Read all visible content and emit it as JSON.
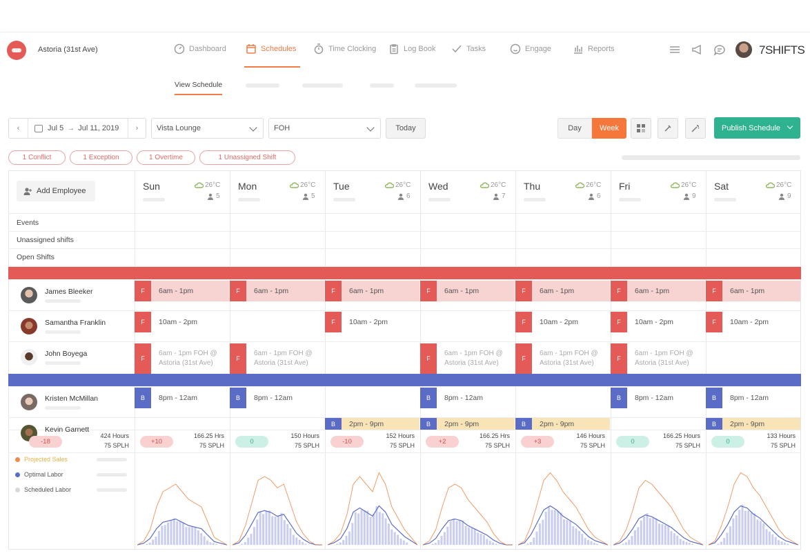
{
  "header": {
    "location": "Astoria (31st Ave)",
    "brand": "7SHIFTS",
    "nav": [
      {
        "label": "Dashboard",
        "icon": "dashboard-icon",
        "active": false
      },
      {
        "label": "Schedules",
        "icon": "calendar-icon",
        "active": true
      },
      {
        "label": "Time Clocking",
        "icon": "stopwatch-icon",
        "active": false
      },
      {
        "label": "Log Book",
        "icon": "clipboard-icon",
        "active": false
      },
      {
        "label": "Tasks",
        "icon": "check-icon",
        "active": false
      },
      {
        "label": "Engage",
        "icon": "smiley-icon",
        "active": false
      },
      {
        "label": "Reports",
        "icon": "bar-chart-icon",
        "active": false
      }
    ]
  },
  "subnav": {
    "active_tab": "View Schedule"
  },
  "toolbar": {
    "date_start": "Jul 5",
    "date_arrow": "→",
    "date_end": "Jul 11, 2019",
    "location_select": "Vista Lounge",
    "department_select": "FOH",
    "today_label": "Today",
    "view_day": "Day",
    "view_week": "Week",
    "publish_label": "Publish Schedule"
  },
  "alerts": [
    "1 Conflict",
    "1 Exception",
    "1 Overtime",
    "1 Unassigned Shift"
  ],
  "grid": {
    "add_employee_label": "Add Employee",
    "section_rows": [
      "Events",
      "Unassigned shifts",
      "Open Shifts"
    ],
    "days": [
      {
        "name": "Sun",
        "temp": "26°C",
        "staff": "5"
      },
      {
        "name": "Mon",
        "temp": "26°C",
        "staff": "5"
      },
      {
        "name": "Tue",
        "temp": "26°C",
        "staff": "6"
      },
      {
        "name": "Wed",
        "temp": "26°C",
        "staff": "7"
      },
      {
        "name": "Thu",
        "temp": "26°C",
        "staff": "6"
      },
      {
        "name": "Fri",
        "temp": "26°C",
        "staff": "9"
      },
      {
        "name": "Sat",
        "temp": "26°C",
        "staff": "9"
      }
    ],
    "employees": [
      {
        "name": "James Bleeker",
        "role": "F",
        "shifts": [
          "6am - 1pm",
          "6am - 1pm",
          "6am - 1pm",
          "6am - 1pm",
          "6am - 1pm",
          "6am - 1pm",
          "6am - 1pm"
        ]
      },
      {
        "name": "Samantha Franklin",
        "role": "F",
        "shifts": [
          "10am - 2pm",
          "",
          "10am - 2pm",
          "",
          "10am - 2pm",
          "10am - 2pm",
          "10am - 2pm"
        ]
      },
      {
        "name": "John Boyega",
        "role": "F",
        "shifts": [
          "6am - 1pm FOH @ Astoria (31st Ave)",
          "6am - 1pm FOH @ Astoria (31st Ave)",
          "",
          "6am - 1pm FOH @ Astoria (31st Ave)",
          "6am - 1pm FOH @ Astoria (31st Ave)",
          "6am - 1pm FOH @ Astoria (31st Ave)",
          ""
        ]
      },
      {
        "name": "Kristen McMillan",
        "role": "B",
        "shifts": [
          "8pm - 12am",
          "8pm - 12am",
          "",
          "8pm - 12am",
          "",
          "8pm - 12am",
          "8pm - 12am"
        ]
      },
      {
        "name": "Kevin Garnett",
        "role": "B",
        "shifts": [
          "",
          "",
          "2pm - 9pm",
          "2pm - 9pm",
          "2pm - 9pm",
          "",
          "2pm - 9pm"
        ]
      }
    ],
    "summary": {
      "total_variance": "-18",
      "total_hours": "424 Hours",
      "total_splh": "75 SPLH",
      "days": [
        {
          "variance": "+10",
          "hours": "166.25 Hrs",
          "splh": "75 SPLH"
        },
        {
          "variance": "0",
          "hours": "150 Hours",
          "splh": "75 SPLH"
        },
        {
          "variance": "-10",
          "hours": "152 Hours",
          "splh": "75 SPLH"
        },
        {
          "variance": "+2",
          "hours": "166.25 Hrs",
          "splh": "75 SPLH"
        },
        {
          "variance": "+3",
          "hours": "146 Hours",
          "splh": "75 SPLH"
        },
        {
          "variance": "0",
          "hours": "166.25 Hours",
          "splh": "75 SPLH"
        },
        {
          "variance": "0",
          "hours": "133 Hours",
          "splh": "75 SPLH"
        }
      ]
    },
    "legend": [
      {
        "label": "Projected Sales",
        "color": "#f08a4b"
      },
      {
        "label": "Optimal Labor",
        "color": "#5b6cc6"
      },
      {
        "label": "Scheduled Labor",
        "color": "#d8d8d8"
      }
    ]
  },
  "colors": {
    "accent": "#f07b45",
    "foh": "#e35a57",
    "foh_light": "#f7d3d2",
    "bar": "#5b6cc6",
    "bar_shift": "#f9e4b8",
    "publish": "#2fb28f"
  }
}
